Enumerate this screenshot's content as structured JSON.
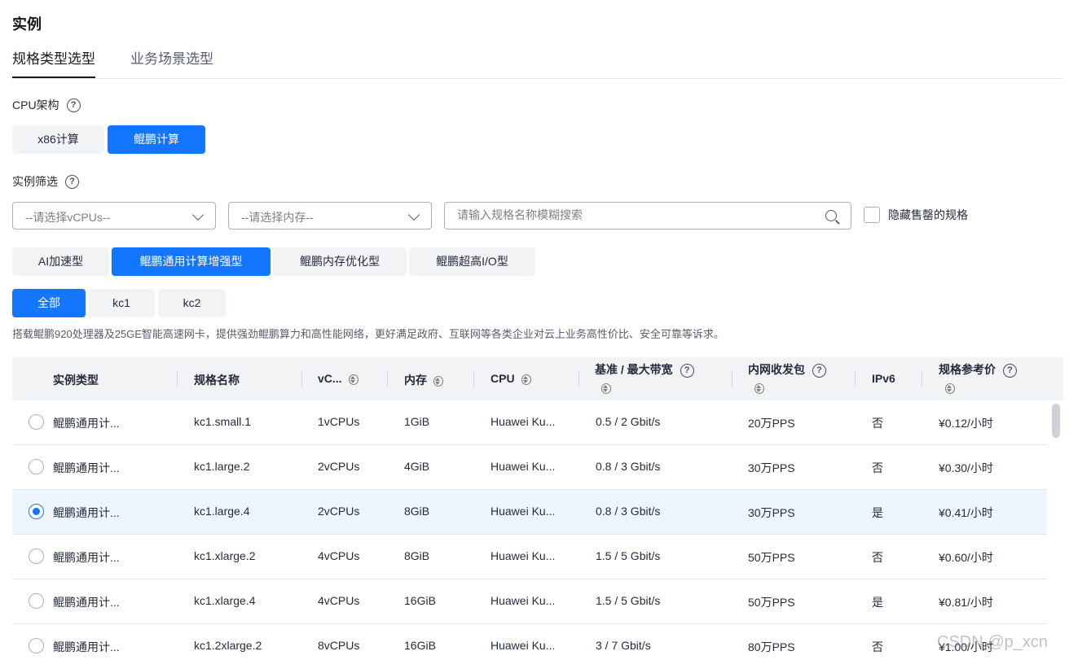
{
  "section_title": "实例",
  "tabs": [
    {
      "label": "规格类型选型",
      "active": true
    },
    {
      "label": "业务场景选型",
      "active": false
    }
  ],
  "cpu_arch": {
    "label": "CPU架构",
    "options": [
      {
        "label": "x86计算",
        "selected": false
      },
      {
        "label": "鲲鹏计算",
        "selected": true
      }
    ]
  },
  "filter": {
    "label": "实例筛选",
    "vcpus_placeholder": "--请选择vCPUs--",
    "memory_placeholder": "--请选择内存--",
    "search_placeholder": "请输入规格名称模糊搜索",
    "hide_sold_out_label": "隐藏售罄的规格"
  },
  "type_tabs": [
    {
      "label": "AI加速型",
      "selected": false
    },
    {
      "label": "鲲鹏通用计算增强型",
      "selected": true
    },
    {
      "label": "鲲鹏内存优化型",
      "selected": false
    },
    {
      "label": "鲲鹏超高I/O型",
      "selected": false
    }
  ],
  "sub_tabs": [
    {
      "label": "全部",
      "selected": true
    },
    {
      "label": "kc1",
      "selected": false
    },
    {
      "label": "kc2",
      "selected": false
    }
  ],
  "description": "搭载鲲鹏920处理器及25GE智能高速网卡，提供强劲鲲鹏算力和高性能网络，更好满足政府、互联网等各类企业对云上业务高性价比、安全可靠等诉求。",
  "table": {
    "headers": {
      "type": "实例类型",
      "name": "规格名称",
      "vcpus": "vC...",
      "memory": "内存",
      "cpu": "CPU",
      "bandwidth": "基准 / 最大带宽",
      "pps": "内网收发包",
      "ipv6": "IPv6",
      "price": "规格参考价"
    },
    "rows": [
      {
        "type": "鲲鹏通用计...",
        "name": "kc1.small.1",
        "vcpus": "1vCPUs",
        "memory": "1GiB",
        "cpu": "Huawei Ku...",
        "bandwidth": "0.5 / 2 Gbit/s",
        "pps": "20万PPS",
        "ipv6": "否",
        "price": "¥0.12/小时",
        "selected": false
      },
      {
        "type": "鲲鹏通用计...",
        "name": "kc1.large.2",
        "vcpus": "2vCPUs",
        "memory": "4GiB",
        "cpu": "Huawei Ku...",
        "bandwidth": "0.8 / 3 Gbit/s",
        "pps": "30万PPS",
        "ipv6": "否",
        "price": "¥0.30/小时",
        "selected": false
      },
      {
        "type": "鲲鹏通用计...",
        "name": "kc1.large.4",
        "vcpus": "2vCPUs",
        "memory": "8GiB",
        "cpu": "Huawei Ku...",
        "bandwidth": "0.8 / 3 Gbit/s",
        "pps": "30万PPS",
        "ipv6": "是",
        "price": "¥0.41/小时",
        "selected": true
      },
      {
        "type": "鲲鹏通用计...",
        "name": "kc1.xlarge.2",
        "vcpus": "4vCPUs",
        "memory": "8GiB",
        "cpu": "Huawei Ku...",
        "bandwidth": "1.5 / 5 Gbit/s",
        "pps": "50万PPS",
        "ipv6": "否",
        "price": "¥0.60/小时",
        "selected": false
      },
      {
        "type": "鲲鹏通用计...",
        "name": "kc1.xlarge.4",
        "vcpus": "4vCPUs",
        "memory": "16GiB",
        "cpu": "Huawei Ku...",
        "bandwidth": "1.5 / 5 Gbit/s",
        "pps": "50万PPS",
        "ipv6": "是",
        "price": "¥0.81/小时",
        "selected": false
      },
      {
        "type": "鲲鹏通用计...",
        "name": "kc1.2xlarge.2",
        "vcpus": "8vCPUs",
        "memory": "16GiB",
        "cpu": "Huawei Ku...",
        "bandwidth": "3 / 7 Gbit/s",
        "pps": "80万PPS",
        "ipv6": "否",
        "price": "¥1.00/小时",
        "selected": false
      }
    ]
  },
  "watermark": "CSDN @p_xcn",
  "colors": {
    "accent": "#1476ff",
    "selected_row": "#eef5ff",
    "header_bg": "#f2f3f5"
  },
  "icons": {
    "help": "question-circle-icon",
    "search": "search-icon",
    "dropdown": "chevron-down-icon",
    "sort": "sort-icon"
  }
}
